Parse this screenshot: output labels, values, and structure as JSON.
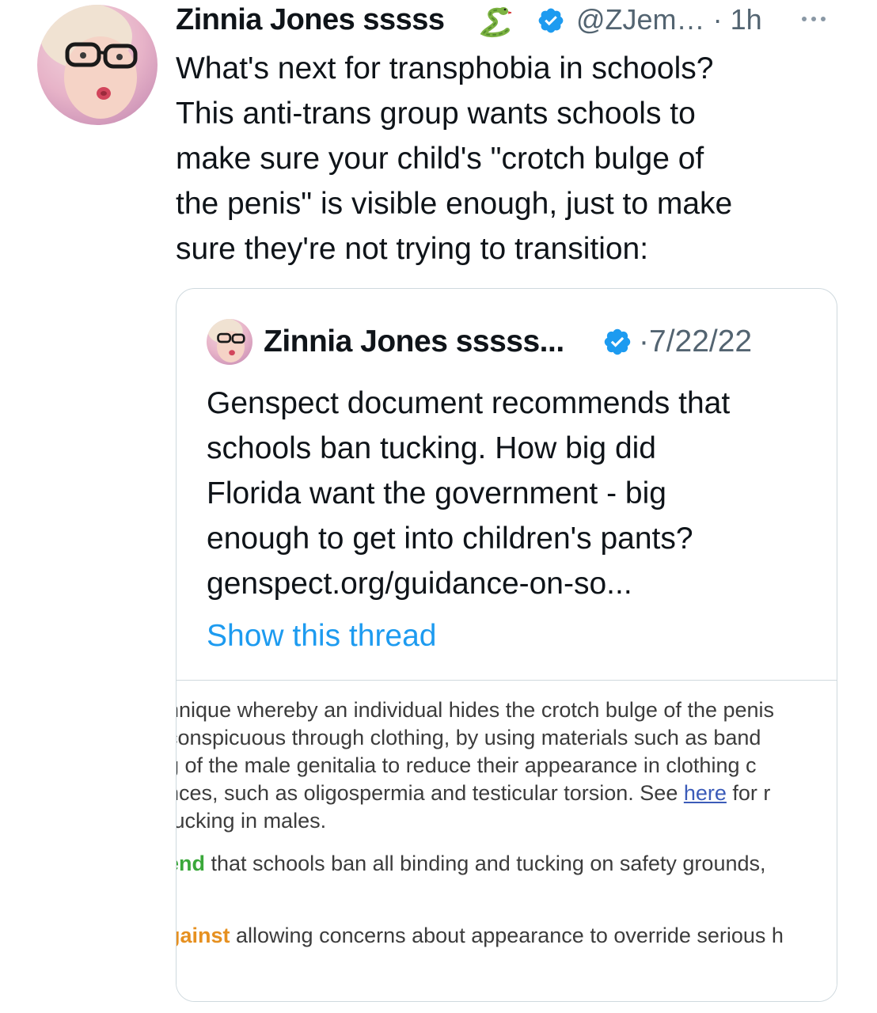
{
  "tweet": {
    "author_name": "Zinnia Jones sssss",
    "handle": "@ZJem…",
    "separator": "·",
    "time": "1h",
    "text": "What's next for transphobia in schools?\nThis anti-trans group wants schools to\nmake sure your child's \"crotch bulge of\nthe penis\" is visible enough, just to make\nsure they're not trying to transition:",
    "icons": {
      "avatar": "avatar-photo",
      "name_emoji": "snake-icon",
      "verified": "verified-badge-icon",
      "more": "more-options-icon"
    }
  },
  "quoted_tweet": {
    "author_name": "Zinnia Jones sssss...",
    "separator": "·",
    "date": "7/22/22",
    "text": "Genspect document recommends that\nschools ban tucking. How big did\nFlorida want the government - big\nenough to get into children's pants?\ngenspect.org/guidance-on-so...",
    "show_thread": "Show this thread",
    "image_excerpt": {
      "line1": "nnique whereby an individual hides the crotch bulge of the penis",
      "line2": " conspicuous through clothing, by using materials such as band",
      "line3": "g of the male genitalia to reduce their appearance in clothing c",
      "line4_a": "nces, such as oligospermia and testicular torsion. See ",
      "line4_link": "here",
      "line4_b": " for r",
      "line5": "tucking in males.",
      "line6_kw": "end",
      "line6_rest": " that schools ban all binding and tucking on safety grounds,",
      "line7_kw": "gainst",
      "line7_rest": " allowing concerns about appearance to override serious h"
    }
  },
  "colors": {
    "text": "#0f1419",
    "secondary": "#536471",
    "link": "#1d9bf0",
    "verified": "#1d9bf0",
    "border": "#cfd9de",
    "keyword_green": "#3aa83a",
    "keyword_orange": "#e69020"
  }
}
